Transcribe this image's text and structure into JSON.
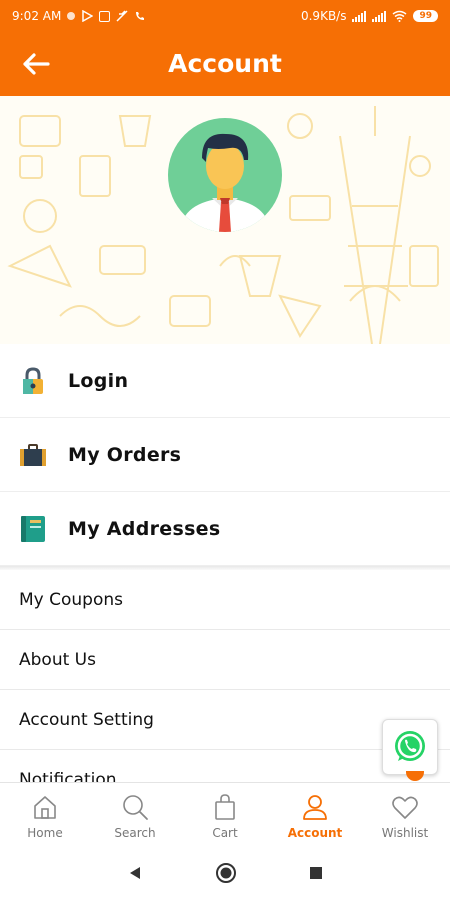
{
  "status_bar": {
    "time": "9:02 AM",
    "network_speed": "0.9KB/s",
    "battery": "99",
    "icons": [
      "record-dot-icon",
      "play-store-icon",
      "notification-box-icon",
      "mute-icon",
      "missed-call-icon",
      "signal-icon",
      "signal-icon",
      "wifi-icon",
      "battery-icon"
    ]
  },
  "appbar": {
    "back_icon": "arrow-left-icon",
    "title": "Account"
  },
  "profile": {
    "avatar_icon": "user-avatar-icon"
  },
  "menu": {
    "primary_items": [
      {
        "label": "Login",
        "icon": "padlock-icon"
      },
      {
        "label": "My Orders",
        "icon": "briefcase-icon"
      },
      {
        "label": "My Addresses",
        "icon": "address-book-icon"
      }
    ],
    "secondary_items": [
      {
        "label": "My Coupons"
      },
      {
        "label": "About Us"
      },
      {
        "label": "Account Setting"
      },
      {
        "label": "Notification"
      }
    ]
  },
  "floating": {
    "icon": "whatsapp-icon"
  },
  "bottom_nav": {
    "items": [
      {
        "label": "Home",
        "icon": "home-icon"
      },
      {
        "label": "Search",
        "icon": "search-icon"
      },
      {
        "label": "Cart",
        "icon": "shopping-bag-icon"
      },
      {
        "label": "Account",
        "icon": "user-icon",
        "active": true
      },
      {
        "label": "Wishlist",
        "icon": "heart-icon"
      }
    ]
  },
  "system_nav": [
    "back-triangle-icon",
    "home-circle-icon",
    "recents-square-icon"
  ],
  "colors": {
    "brand": "#f66f05",
    "text": "#111111",
    "inactive": "#777777",
    "whatsapp": "#25d366"
  }
}
